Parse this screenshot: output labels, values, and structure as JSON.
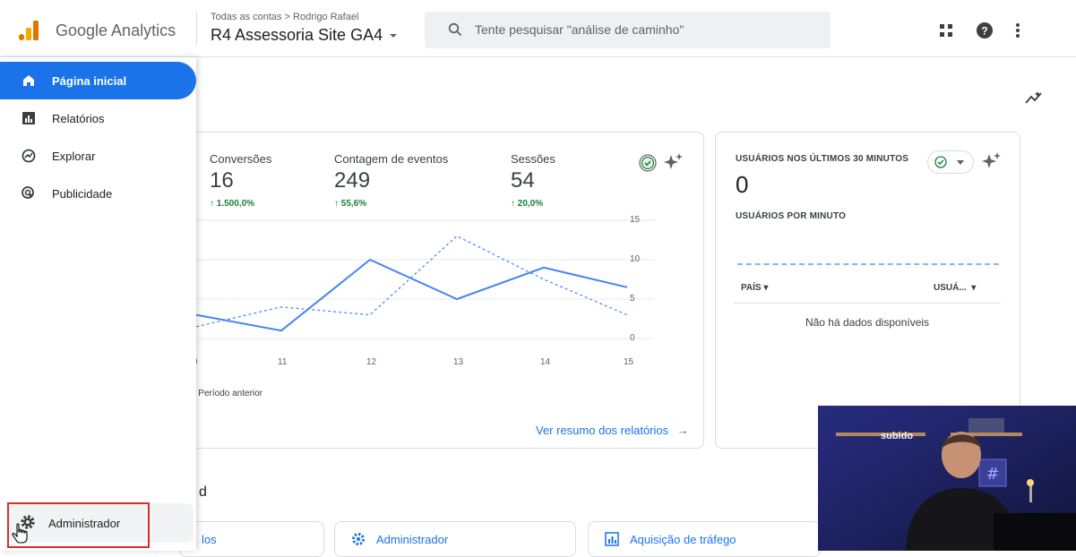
{
  "header": {
    "brand": "Google Analytics",
    "breadcrumb": "Todas as contas > Rodrigo Rafael",
    "property": "R4 Assessoria Site GA4",
    "search_placeholder": "Tente pesquisar \"análise de caminho\""
  },
  "sidebar": {
    "items": [
      {
        "label": "Página inicial",
        "icon": "home-icon"
      },
      {
        "label": "Relatórios",
        "icon": "reports-icon"
      },
      {
        "label": "Explorar",
        "icon": "explore-icon"
      },
      {
        "label": "Publicidade",
        "icon": "advertising-icon"
      }
    ],
    "admin_label": "Administrador"
  },
  "overview": {
    "metrics": [
      {
        "label": "Conversões",
        "value": "16",
        "delta": "↑ 1.500,0%"
      },
      {
        "label": "Contagem de eventos",
        "value": "249",
        "delta": "↑ 55,6%"
      },
      {
        "label": "Sessões",
        "value": "54",
        "delta": "↑ 20,0%"
      }
    ],
    "x_ticks": [
      "0",
      "11",
      "12",
      "13",
      "14",
      "15"
    ],
    "y_ticks": [
      "15",
      "10",
      "5",
      "0"
    ],
    "legend_previous": "Período anterior",
    "link": "Ver resumo dos relatórios",
    "current_series": [
      3,
      1,
      10,
      5,
      9,
      6.5
    ],
    "previous_series": [
      1.5,
      4,
      3,
      13,
      7.5,
      3
    ]
  },
  "realtime": {
    "title": "USUÁRIOS NOS ÚLTIMOS 30 MINUTOS",
    "value": "0",
    "subtitle": "USUÁRIOS POR MINUTO",
    "col_country": "PAÍS",
    "col_users": "USUÁ...",
    "empty": "Não há dados disponíveis"
  },
  "section_title_partial": "d",
  "bottom_cards": [
    {
      "label": "los"
    },
    {
      "label": "Administrador"
    },
    {
      "label": "Aquisição de tráfego"
    }
  ],
  "video": {
    "label": "subido"
  },
  "colors": {
    "accent": "#1a73e8",
    "positive": "#188038",
    "highlight": "#d93025"
  }
}
